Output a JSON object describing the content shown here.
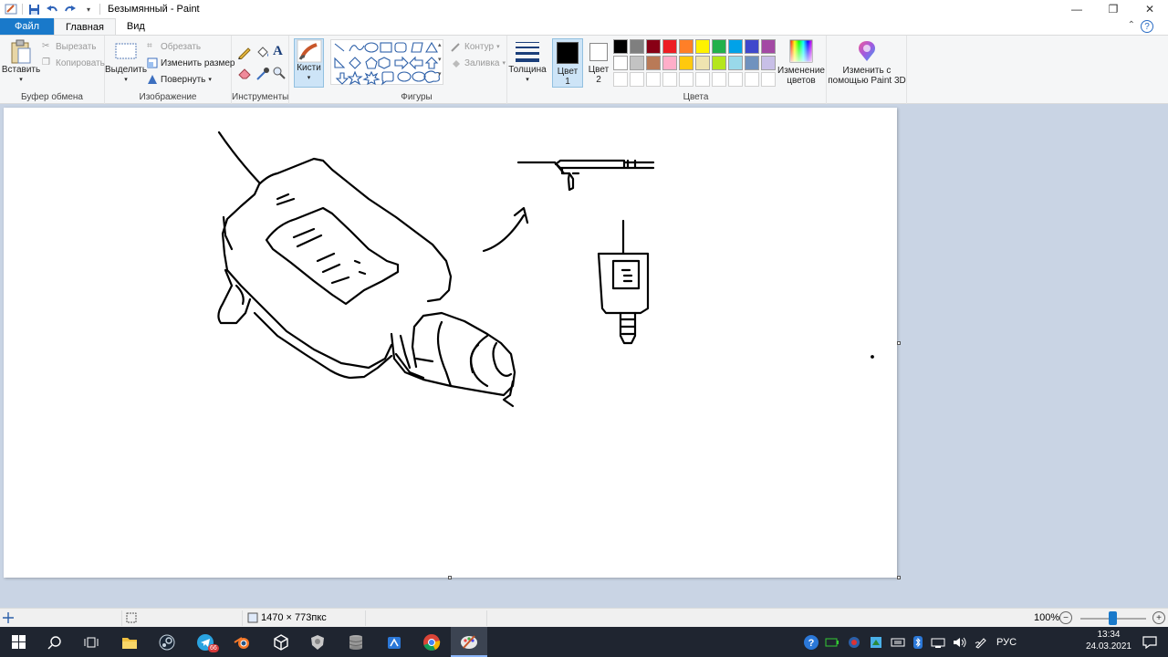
{
  "window": {
    "title": "Безымянный - Paint",
    "min_glyph": "—",
    "max_glyph": "❐",
    "close_glyph": "✕"
  },
  "tabs": {
    "file": "Файл",
    "home": "Главная",
    "view": "Вид"
  },
  "ribbon": {
    "clipboard": {
      "label": "Буфер обмена",
      "paste": "Вставить",
      "cut": "Вырезать",
      "copy": "Копировать"
    },
    "image": {
      "label": "Изображение",
      "select": "Выделить",
      "crop": "Обрезать",
      "resize": "Изменить размер",
      "rotate": "Повернуть"
    },
    "tools": {
      "label": "Инструменты"
    },
    "brushes": {
      "label": "Кисти"
    },
    "shapes": {
      "label": "Фигуры",
      "outline": "Контур",
      "fill": "Заливка"
    },
    "thickness": {
      "label": "Толщина"
    },
    "color1": {
      "label": "Цвет",
      "num": "1"
    },
    "color2": {
      "label": "Цвет",
      "num": "2"
    },
    "colors": {
      "label": "Цвета",
      "row1": [
        "#000000",
        "#7f7f7f",
        "#880015",
        "#ed1c24",
        "#ff7f27",
        "#fff200",
        "#22b14c",
        "#00a2e8",
        "#3f48cc",
        "#a349a4"
      ],
      "row2": [
        "#ffffff",
        "#c3c3c3",
        "#b97a57",
        "#ffaec9",
        "#ffc90e",
        "#efe4b0",
        "#b5e61d",
        "#99d9ea",
        "#7092be",
        "#c8bfe7"
      ]
    },
    "edit_colors": {
      "line1": "Изменение",
      "line2": "цветов"
    },
    "paint3d": {
      "line1": "Изменить с",
      "line2": "помощью Paint 3D"
    }
  },
  "status": {
    "canvas_size": "1470 × 773пкс",
    "zoom": "100%"
  },
  "taskbar": {
    "telegram_badge": "66",
    "lang": "РУС",
    "time": "13:34",
    "date": "24.03.2021"
  }
}
